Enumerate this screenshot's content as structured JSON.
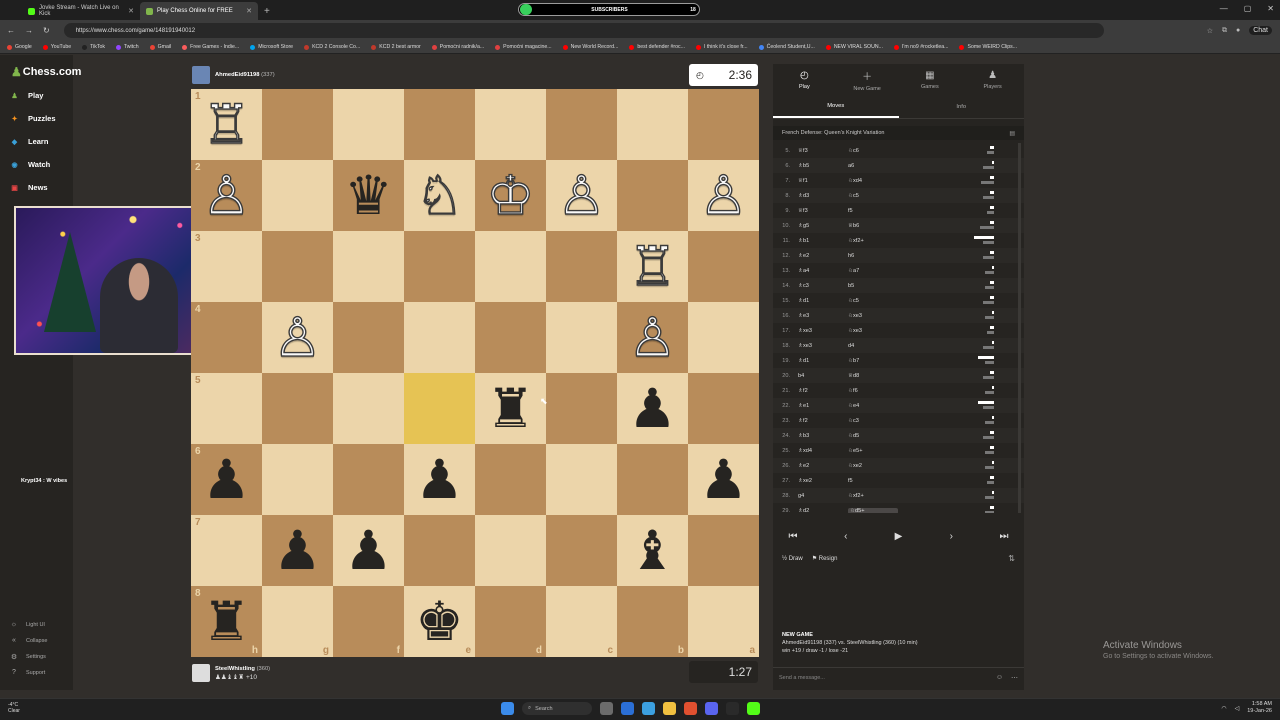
{
  "browser": {
    "tabs": [
      {
        "title": "Jovke Stream - Watch Live on Kick",
        "color": "#53fc18",
        "active": false
      },
      {
        "title": "Play Chess Online for FREE",
        "color": "#81b64c",
        "active": true
      }
    ],
    "url": "https://www.chess.com/game/148191940012",
    "subscribers_label": "SUBSCRIBERS",
    "subscribers_count": "18",
    "subscribers_progress": 0.06,
    "chat_label": "Chat",
    "bookmarks": [
      "Google",
      "YouTube",
      "TikTok",
      "Twitch",
      "Gmail",
      "Free Games - Indie...",
      "Microsoft Store",
      "KCD 2 Console Co...",
      "KCD 2 best armor",
      "Pomoćni radnik/a...",
      "Pomoćni magacine...",
      "New World Record...",
      "best defender #roc...",
      "I think it's close fr...",
      "Ćeolend Student,U...",
      "NEW VIRAL SOUN...",
      "I'm no9 #rocketlea...",
      "Some WEIRD Clips..."
    ]
  },
  "sidebar": {
    "logo": "Chess.com",
    "items": [
      {
        "label": "Play",
        "icon": "play-icon",
        "color": "#81b64c"
      },
      {
        "label": "Puzzles",
        "icon": "puzzle-icon",
        "color": "#f7931e"
      },
      {
        "label": "Learn",
        "icon": "learn-icon",
        "color": "#3aa0d8"
      },
      {
        "label": "Watch",
        "icon": "watch-icon",
        "color": "#3aa0d8"
      },
      {
        "label": "News",
        "icon": "news-icon",
        "color": "#e64545"
      }
    ],
    "footer": [
      {
        "label": "Light UI",
        "icon": "sun-icon"
      },
      {
        "label": "Collapse",
        "icon": "collapse-icon"
      },
      {
        "label": "Settings",
        "icon": "gear-icon"
      },
      {
        "label": "Support",
        "icon": "help-icon"
      }
    ]
  },
  "overlay_text": "Krypt34 : W vibes",
  "players": {
    "top": {
      "name": "AhmedEid91198",
      "rating": "(337)",
      "clock": "2:36"
    },
    "bottom": {
      "name": "SteelWhistling",
      "rating": "(360)",
      "captures": "♟♟♝♝♜ +10",
      "clock": "1:27"
    }
  },
  "board": {
    "orientation": "black",
    "highlight": "e5",
    "ranks": [
      "1",
      "2",
      "3",
      "4",
      "5",
      "6",
      "7",
      "8"
    ],
    "files": [
      "h",
      "g",
      "f",
      "e",
      "d",
      "c",
      "b",
      "a"
    ],
    "rows": [
      [
        "wR",
        "",
        "",
        "",
        "",
        "",
        "",
        ""
      ],
      [
        "wP",
        "",
        "bQ",
        "wN",
        "wK",
        "wP",
        "",
        "wP"
      ],
      [
        "",
        "",
        "",
        "",
        "",
        "",
        "wR",
        ""
      ],
      [
        "",
        "wP",
        "",
        "",
        "",
        "",
        "wP",
        ""
      ],
      [
        "",
        "",
        "",
        "",
        "bR",
        "",
        "bP",
        ""
      ],
      [
        "bP",
        "",
        "",
        "bP",
        "",
        "",
        "",
        "bP"
      ],
      [
        "",
        "bP",
        "bP",
        "",
        "",
        "",
        "bB",
        ""
      ],
      [
        "bR",
        "",
        "",
        "bK",
        "",
        "",
        "",
        ""
      ]
    ]
  },
  "panel": {
    "tabs": [
      {
        "label": "Play",
        "icon": "clock-icon"
      },
      {
        "label": "New Game",
        "icon": "plus-icon"
      },
      {
        "label": "Games",
        "icon": "games-icon"
      },
      {
        "label": "Players",
        "icon": "players-icon"
      }
    ],
    "subtabs": [
      "Moves",
      "Info"
    ],
    "opening": "French Defense: Queen's Knight Variation",
    "moves": [
      {
        "n": "5.",
        "w": "♕f3",
        "b": "♘c6",
        "wt": 0.1,
        "bt": 0.2
      },
      {
        "n": "6.",
        "w": "♗b5",
        "b": "a6",
        "wt": 0.05,
        "bt": 0.3
      },
      {
        "n": "7.",
        "w": "♕f1",
        "b": "♘xd4",
        "wt": 0.1,
        "bt": 0.35
      },
      {
        "n": "8.",
        "w": "♗d3",
        "b": "♘c5",
        "wt": 0.1,
        "bt": 0.3
      },
      {
        "n": "9.",
        "w": "♕f3",
        "b": "f5",
        "wt": 0.1,
        "bt": 0.2
      },
      {
        "n": "10.",
        "w": "♗g5",
        "b": "♕b6",
        "wt": 0.1,
        "bt": 0.4
      },
      {
        "n": "11.",
        "w": "♗b1",
        "b": "♘xf2+",
        "wt": 0.55,
        "bt": 0.3
      },
      {
        "n": "12.",
        "w": "♗e2",
        "b": "h6",
        "wt": 0.1,
        "bt": 0.3
      },
      {
        "n": "13.",
        "w": "♗a4",
        "b": "♘a7",
        "wt": 0.05,
        "bt": 0.25
      },
      {
        "n": "14.",
        "w": "♗c3",
        "b": "b5",
        "wt": 0.1,
        "bt": 0.25
      },
      {
        "n": "15.",
        "w": "♗d1",
        "b": "♘c5",
        "wt": 0.1,
        "bt": 0.3
      },
      {
        "n": "16.",
        "w": "♗e3",
        "b": "♘xe3",
        "wt": 0.05,
        "bt": 0.25
      },
      {
        "n": "17.",
        "w": "♗xe3",
        "b": "♘xe3",
        "wt": 0.1,
        "bt": 0.2
      },
      {
        "n": "18.",
        "w": "♗xe3",
        "b": "d4",
        "wt": 0.05,
        "bt": 0.3
      },
      {
        "n": "19.",
        "w": "♗d1",
        "b": "♘b7",
        "wt": 0.45,
        "bt": 0.25
      },
      {
        "n": "20.",
        "w": "b4",
        "b": "♕d8",
        "wt": 0.1,
        "bt": 0.3
      },
      {
        "n": "21.",
        "w": "♗f2",
        "b": "♘f6",
        "wt": 0.05,
        "bt": 0.25
      },
      {
        "n": "22.",
        "w": "♗e1",
        "b": "♘e4",
        "wt": 0.45,
        "bt": 0.3
      },
      {
        "n": "23.",
        "w": "♗f2",
        "b": "♘c3",
        "wt": 0.05,
        "bt": 0.25
      },
      {
        "n": "24.",
        "w": "♗b3",
        "b": "♘d5",
        "wt": 0.1,
        "bt": 0.3
      },
      {
        "n": "25.",
        "w": "♗xd4",
        "b": "♘e5+",
        "wt": 0.1,
        "bt": 0.25
      },
      {
        "n": "26.",
        "w": "♗e2",
        "b": "♘xe2",
        "wt": 0.05,
        "bt": 0.25
      },
      {
        "n": "27.",
        "w": "♗xe2",
        "b": "f5",
        "wt": 0.1,
        "bt": 0.2
      },
      {
        "n": "28.",
        "w": "g4",
        "b": "♘xf2+",
        "wt": 0.05,
        "bt": 0.25
      },
      {
        "n": "29.",
        "w": "♗d2",
        "b": "♘d5+",
        "wt": 0.1,
        "bt": 0.25
      }
    ],
    "actions": {
      "draw": "Draw",
      "resign": "Resign"
    },
    "new_game": {
      "heading": "NEW GAME",
      "line1": "AhmedEid91198 (337) vs. SteelWhistling (360) (10 min)",
      "line2": "win +19 / draw -1 / lose -21"
    },
    "message_placeholder": "Send a message..."
  },
  "activate": {
    "title": "Activate Windows",
    "subtitle": "Go to Settings to activate Windows."
  },
  "taskbar": {
    "weather_temp": "-4°C",
    "weather_desc": "Clear",
    "search": "Search",
    "time": "1:58 AM",
    "date": "19-Jan-26"
  }
}
